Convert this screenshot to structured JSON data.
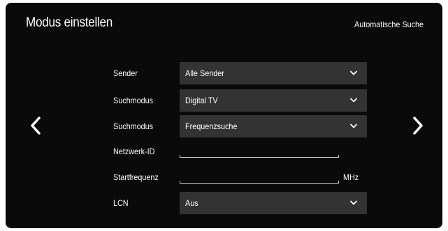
{
  "header": {
    "title": "Modus einstellen",
    "mode": "Automatische Suche"
  },
  "navigation": {
    "left_icon": "chevron-left-icon",
    "right_icon": "chevron-right-icon"
  },
  "form": {
    "sender": {
      "label": "Sender",
      "value": "Alle Sender"
    },
    "suchmodus_1": {
      "label": "Suchmodus",
      "value": "Digital TV"
    },
    "suchmodus_2": {
      "label": "Suchmodus",
      "value": "Frequenzsuche"
    },
    "netzwerk_id": {
      "label": "Netzwerk-ID",
      "value": ""
    },
    "startfrequenz": {
      "label": "Startfrequenz",
      "value": "",
      "unit": "MHz"
    },
    "lcn": {
      "label": "LCN",
      "value": "Aus"
    }
  },
  "colors": {
    "background": "#0a0a0a",
    "field": "#333333",
    "text": "#ffffff"
  }
}
